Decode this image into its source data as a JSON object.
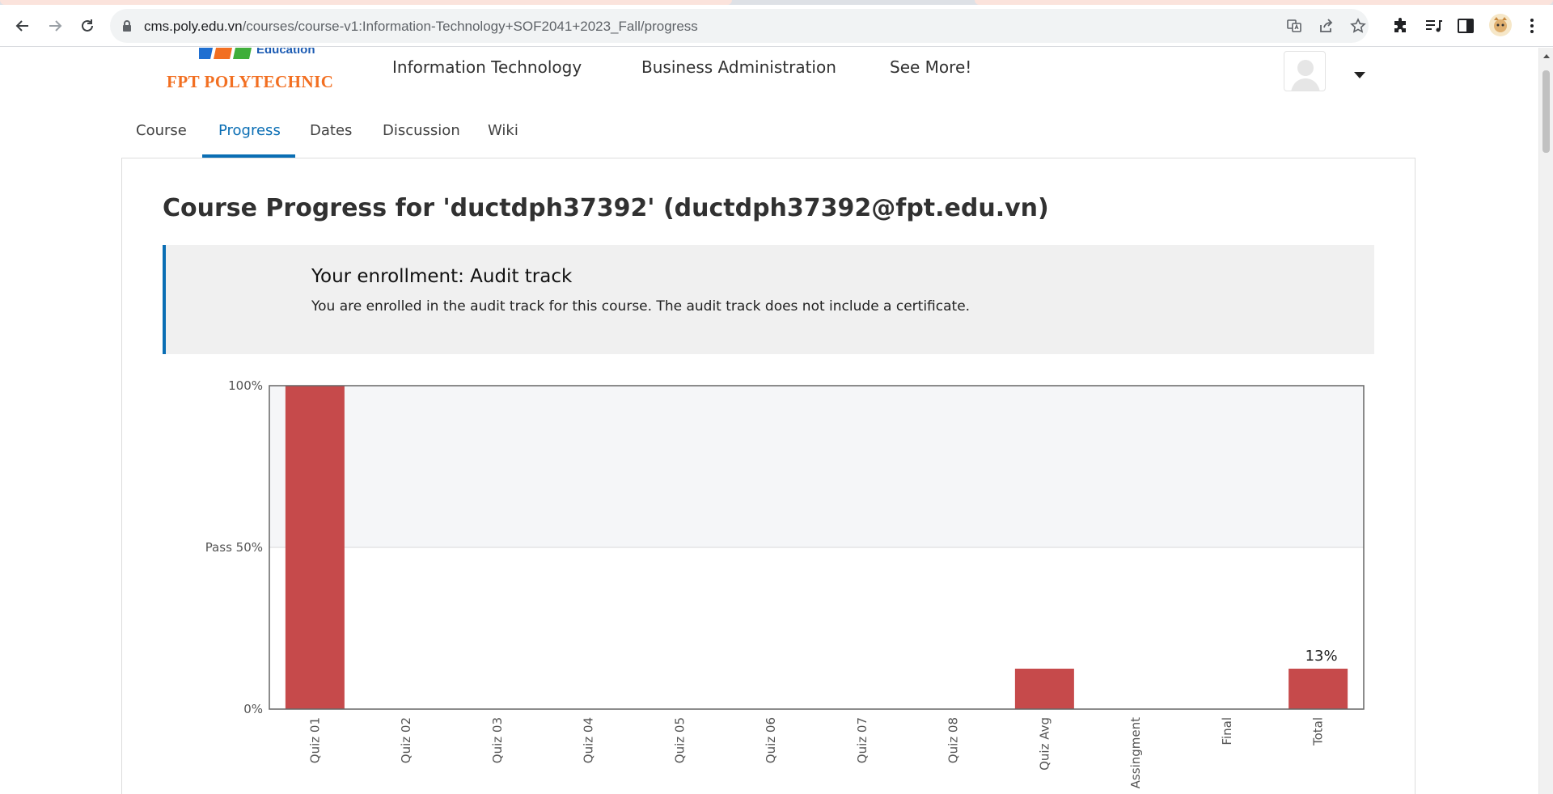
{
  "browser": {
    "url_host": "cms.poly.edu.vn",
    "url_path": "/courses/course-v1:Information-Technology+SOF2041+2023_Fall/progress"
  },
  "header": {
    "logo_education": "Education",
    "logo_brand": "FPT POLYTECHNIC",
    "nav": [
      "Information Technology",
      "Business Administration",
      "See More!"
    ]
  },
  "course_tabs": [
    {
      "label": "Course"
    },
    {
      "label": "Progress",
      "active": true
    },
    {
      "label": "Dates"
    },
    {
      "label": "Discussion"
    },
    {
      "label": "Wiki"
    }
  ],
  "main": {
    "title": "Course Progress for 'ductdph37392' (ductdph37392@fpt.edu.vn)",
    "enrollment_title": "Your enrollment: Audit track",
    "enrollment_message": "You are enrolled in the audit track for this course. The audit track does not include a certificate."
  },
  "colors": {
    "accent": "#0a6eb4",
    "bar": "#c64a4b",
    "brand_orange": "#f26f21"
  },
  "chart_data": {
    "type": "bar",
    "categories": [
      "Quiz 01",
      "Quiz 02",
      "Quiz 03",
      "Quiz 04",
      "Quiz 05",
      "Quiz 06",
      "Quiz 07",
      "Quiz 08",
      "Quiz Avg",
      "Assingment",
      "Final",
      "Total"
    ],
    "values": [
      100,
      0,
      0,
      0,
      0,
      0,
      0,
      0,
      12.5,
      0,
      0,
      12.5
    ],
    "y_ticks": [
      {
        "value": 100,
        "label": "100%"
      },
      {
        "value": 50,
        "label": "Pass 50%"
      },
      {
        "value": 0,
        "label": "0%"
      }
    ],
    "annotations": [
      {
        "category": "Total",
        "text": "13%"
      }
    ],
    "pass_threshold": 50,
    "ylim": [
      0,
      100
    ]
  }
}
